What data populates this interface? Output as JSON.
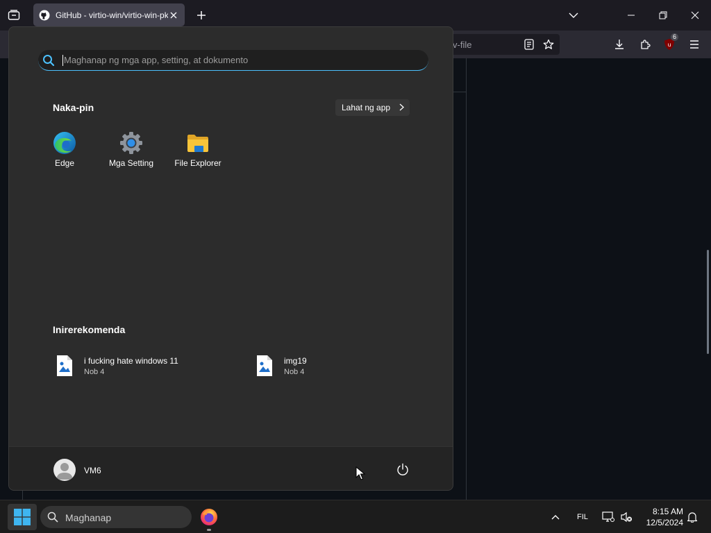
{
  "browser": {
    "tab_title": "GitHub - virtio-win/virtio-win-pkg-scripts",
    "url_fragment": "v-file",
    "extension_badge": "6"
  },
  "start_menu": {
    "search_placeholder": "Maghanap ng mga app, setting, at dokumento",
    "pinned_heading": "Naka-pin",
    "all_apps_label": "Lahat ng app",
    "pinned": [
      {
        "label": "Edge",
        "icon": "edge-icon"
      },
      {
        "label": "Mga Setting",
        "icon": "settings-gear-icon"
      },
      {
        "label": "File Explorer",
        "icon": "folder-icon"
      }
    ],
    "recommended_heading": "Inirerekomenda",
    "recommended": [
      {
        "name": "i fucking hate windows 11",
        "date": "Nob 4",
        "icon": "image-file-icon"
      },
      {
        "name": "img19",
        "date": "Nob 4",
        "icon": "image-file-icon"
      }
    ],
    "user_name": "VM6"
  },
  "taskbar": {
    "search_label": "Maghanap",
    "language": "FIL",
    "time": "8:15 AM",
    "date": "12/5/2024"
  },
  "colors": {
    "accent": "#4cc2ff",
    "start_bg": "#2c2c2c",
    "taskbar_bg": "#1c1c1c",
    "page_bg": "#0d1117"
  }
}
